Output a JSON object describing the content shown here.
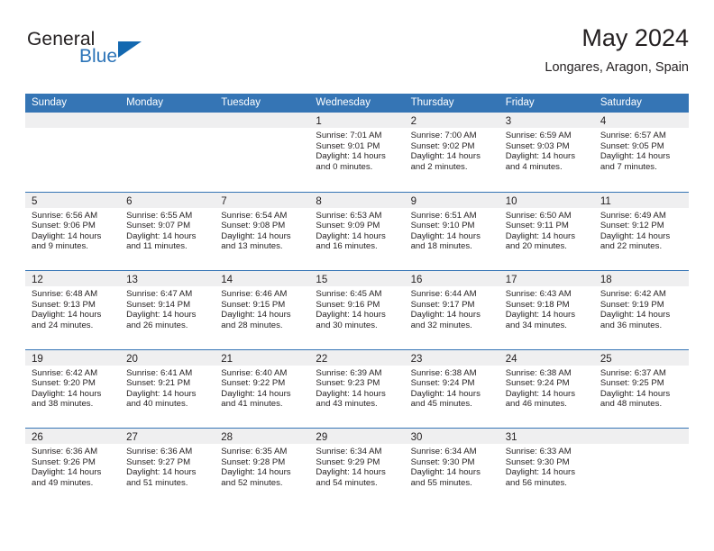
{
  "brand": {
    "general": "General",
    "blue": "Blue",
    "triangle_color": "#1368b0",
    "blue_color": "#2c74b8"
  },
  "header": {
    "title": "May 2024",
    "subtitle": "Longares, Aragon, Spain"
  },
  "theme": {
    "header_row_bg": "#3575b5",
    "day_band_bg": "#efeff0",
    "text_color": "#231f20"
  },
  "weekdays": [
    "Sunday",
    "Monday",
    "Tuesday",
    "Wednesday",
    "Thursday",
    "Friday",
    "Saturday"
  ],
  "weeks": [
    [
      {
        "day": "",
        "sunrise": "",
        "sunset": "",
        "daylight1": "",
        "daylight2": "",
        "empty": true
      },
      {
        "day": "",
        "sunrise": "",
        "sunset": "",
        "daylight1": "",
        "daylight2": "",
        "empty": true
      },
      {
        "day": "",
        "sunrise": "",
        "sunset": "",
        "daylight1": "",
        "daylight2": "",
        "empty": true
      },
      {
        "day": "1",
        "sunrise": "Sunrise: 7:01 AM",
        "sunset": "Sunset: 9:01 PM",
        "daylight1": "Daylight: 14 hours",
        "daylight2": "and 0 minutes.",
        "empty": false
      },
      {
        "day": "2",
        "sunrise": "Sunrise: 7:00 AM",
        "sunset": "Sunset: 9:02 PM",
        "daylight1": "Daylight: 14 hours",
        "daylight2": "and 2 minutes.",
        "empty": false
      },
      {
        "day": "3",
        "sunrise": "Sunrise: 6:59 AM",
        "sunset": "Sunset: 9:03 PM",
        "daylight1": "Daylight: 14 hours",
        "daylight2": "and 4 minutes.",
        "empty": false
      },
      {
        "day": "4",
        "sunrise": "Sunrise: 6:57 AM",
        "sunset": "Sunset: 9:05 PM",
        "daylight1": "Daylight: 14 hours",
        "daylight2": "and 7 minutes.",
        "empty": false
      }
    ],
    [
      {
        "day": "5",
        "sunrise": "Sunrise: 6:56 AM",
        "sunset": "Sunset: 9:06 PM",
        "daylight1": "Daylight: 14 hours",
        "daylight2": "and 9 minutes.",
        "empty": false
      },
      {
        "day": "6",
        "sunrise": "Sunrise: 6:55 AM",
        "sunset": "Sunset: 9:07 PM",
        "daylight1": "Daylight: 14 hours",
        "daylight2": "and 11 minutes.",
        "empty": false
      },
      {
        "day": "7",
        "sunrise": "Sunrise: 6:54 AM",
        "sunset": "Sunset: 9:08 PM",
        "daylight1": "Daylight: 14 hours",
        "daylight2": "and 13 minutes.",
        "empty": false
      },
      {
        "day": "8",
        "sunrise": "Sunrise: 6:53 AM",
        "sunset": "Sunset: 9:09 PM",
        "daylight1": "Daylight: 14 hours",
        "daylight2": "and 16 minutes.",
        "empty": false
      },
      {
        "day": "9",
        "sunrise": "Sunrise: 6:51 AM",
        "sunset": "Sunset: 9:10 PM",
        "daylight1": "Daylight: 14 hours",
        "daylight2": "and 18 minutes.",
        "empty": false
      },
      {
        "day": "10",
        "sunrise": "Sunrise: 6:50 AM",
        "sunset": "Sunset: 9:11 PM",
        "daylight1": "Daylight: 14 hours",
        "daylight2": "and 20 minutes.",
        "empty": false
      },
      {
        "day": "11",
        "sunrise": "Sunrise: 6:49 AM",
        "sunset": "Sunset: 9:12 PM",
        "daylight1": "Daylight: 14 hours",
        "daylight2": "and 22 minutes.",
        "empty": false
      }
    ],
    [
      {
        "day": "12",
        "sunrise": "Sunrise: 6:48 AM",
        "sunset": "Sunset: 9:13 PM",
        "daylight1": "Daylight: 14 hours",
        "daylight2": "and 24 minutes.",
        "empty": false
      },
      {
        "day": "13",
        "sunrise": "Sunrise: 6:47 AM",
        "sunset": "Sunset: 9:14 PM",
        "daylight1": "Daylight: 14 hours",
        "daylight2": "and 26 minutes.",
        "empty": false
      },
      {
        "day": "14",
        "sunrise": "Sunrise: 6:46 AM",
        "sunset": "Sunset: 9:15 PM",
        "daylight1": "Daylight: 14 hours",
        "daylight2": "and 28 minutes.",
        "empty": false
      },
      {
        "day": "15",
        "sunrise": "Sunrise: 6:45 AM",
        "sunset": "Sunset: 9:16 PM",
        "daylight1": "Daylight: 14 hours",
        "daylight2": "and 30 minutes.",
        "empty": false
      },
      {
        "day": "16",
        "sunrise": "Sunrise: 6:44 AM",
        "sunset": "Sunset: 9:17 PM",
        "daylight1": "Daylight: 14 hours",
        "daylight2": "and 32 minutes.",
        "empty": false
      },
      {
        "day": "17",
        "sunrise": "Sunrise: 6:43 AM",
        "sunset": "Sunset: 9:18 PM",
        "daylight1": "Daylight: 14 hours",
        "daylight2": "and 34 minutes.",
        "empty": false
      },
      {
        "day": "18",
        "sunrise": "Sunrise: 6:42 AM",
        "sunset": "Sunset: 9:19 PM",
        "daylight1": "Daylight: 14 hours",
        "daylight2": "and 36 minutes.",
        "empty": false
      }
    ],
    [
      {
        "day": "19",
        "sunrise": "Sunrise: 6:42 AM",
        "sunset": "Sunset: 9:20 PM",
        "daylight1": "Daylight: 14 hours",
        "daylight2": "and 38 minutes.",
        "empty": false
      },
      {
        "day": "20",
        "sunrise": "Sunrise: 6:41 AM",
        "sunset": "Sunset: 9:21 PM",
        "daylight1": "Daylight: 14 hours",
        "daylight2": "and 40 minutes.",
        "empty": false
      },
      {
        "day": "21",
        "sunrise": "Sunrise: 6:40 AM",
        "sunset": "Sunset: 9:22 PM",
        "daylight1": "Daylight: 14 hours",
        "daylight2": "and 41 minutes.",
        "empty": false
      },
      {
        "day": "22",
        "sunrise": "Sunrise: 6:39 AM",
        "sunset": "Sunset: 9:23 PM",
        "daylight1": "Daylight: 14 hours",
        "daylight2": "and 43 minutes.",
        "empty": false
      },
      {
        "day": "23",
        "sunrise": "Sunrise: 6:38 AM",
        "sunset": "Sunset: 9:24 PM",
        "daylight1": "Daylight: 14 hours",
        "daylight2": "and 45 minutes.",
        "empty": false
      },
      {
        "day": "24",
        "sunrise": "Sunrise: 6:38 AM",
        "sunset": "Sunset: 9:24 PM",
        "daylight1": "Daylight: 14 hours",
        "daylight2": "and 46 minutes.",
        "empty": false
      },
      {
        "day": "25",
        "sunrise": "Sunrise: 6:37 AM",
        "sunset": "Sunset: 9:25 PM",
        "daylight1": "Daylight: 14 hours",
        "daylight2": "and 48 minutes.",
        "empty": false
      }
    ],
    [
      {
        "day": "26",
        "sunrise": "Sunrise: 6:36 AM",
        "sunset": "Sunset: 9:26 PM",
        "daylight1": "Daylight: 14 hours",
        "daylight2": "and 49 minutes.",
        "empty": false
      },
      {
        "day": "27",
        "sunrise": "Sunrise: 6:36 AM",
        "sunset": "Sunset: 9:27 PM",
        "daylight1": "Daylight: 14 hours",
        "daylight2": "and 51 minutes.",
        "empty": false
      },
      {
        "day": "28",
        "sunrise": "Sunrise: 6:35 AM",
        "sunset": "Sunset: 9:28 PM",
        "daylight1": "Daylight: 14 hours",
        "daylight2": "and 52 minutes.",
        "empty": false
      },
      {
        "day": "29",
        "sunrise": "Sunrise: 6:34 AM",
        "sunset": "Sunset: 9:29 PM",
        "daylight1": "Daylight: 14 hours",
        "daylight2": "and 54 minutes.",
        "empty": false
      },
      {
        "day": "30",
        "sunrise": "Sunrise: 6:34 AM",
        "sunset": "Sunset: 9:30 PM",
        "daylight1": "Daylight: 14 hours",
        "daylight2": "and 55 minutes.",
        "empty": false
      },
      {
        "day": "31",
        "sunrise": "Sunrise: 6:33 AM",
        "sunset": "Sunset: 9:30 PM",
        "daylight1": "Daylight: 14 hours",
        "daylight2": "and 56 minutes.",
        "empty": false
      },
      {
        "day": "",
        "sunrise": "",
        "sunset": "",
        "daylight1": "",
        "daylight2": "",
        "empty": true
      }
    ]
  ]
}
